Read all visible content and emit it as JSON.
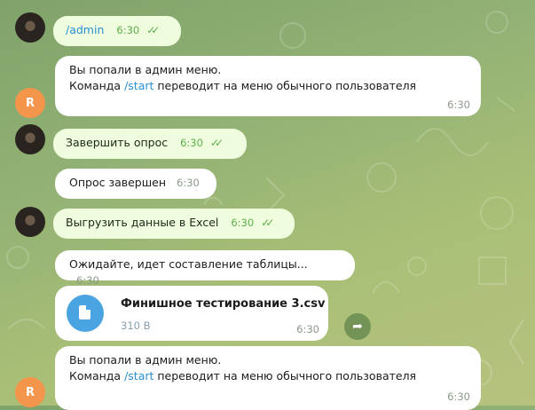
{
  "messages": [
    {
      "text": "/admin",
      "time": "6:30"
    },
    {
      "line1": "Вы попали в админ меню.",
      "line2_pre": "Команда ",
      "line2_cmd": "/start",
      "line2_post": " переводит на меню обычного пользователя",
      "time": "6:30"
    },
    {
      "text": "Завершить опрос",
      "time": "6:30"
    },
    {
      "text": "Опрос завершен",
      "time": "6:30"
    },
    {
      "text": "Выгрузить данные в Excel",
      "time": "6:30"
    },
    {
      "text": "Ожидайте, идет составление таблицы...",
      "time": "6:30"
    },
    {
      "file_name": "Финишное тестирование 3.csv",
      "file_size": "310 B",
      "time": "6:30"
    },
    {
      "line1": "Вы попали в админ меню.",
      "line2_pre": "Команда ",
      "line2_cmd": "/start",
      "line2_post": " переводит на меню обычного пользователя",
      "time": "6:30"
    }
  ],
  "bot_avatar_letter": "R",
  "icons": {
    "check": "double-check-icon",
    "file": "file-icon",
    "share": "share-icon"
  },
  "colors": {
    "outgoing": "#effdde",
    "incoming": "#ffffff",
    "accent": "#4aa4e1",
    "link": "#2a8fd6",
    "avatar_bot": "#f3954b"
  }
}
